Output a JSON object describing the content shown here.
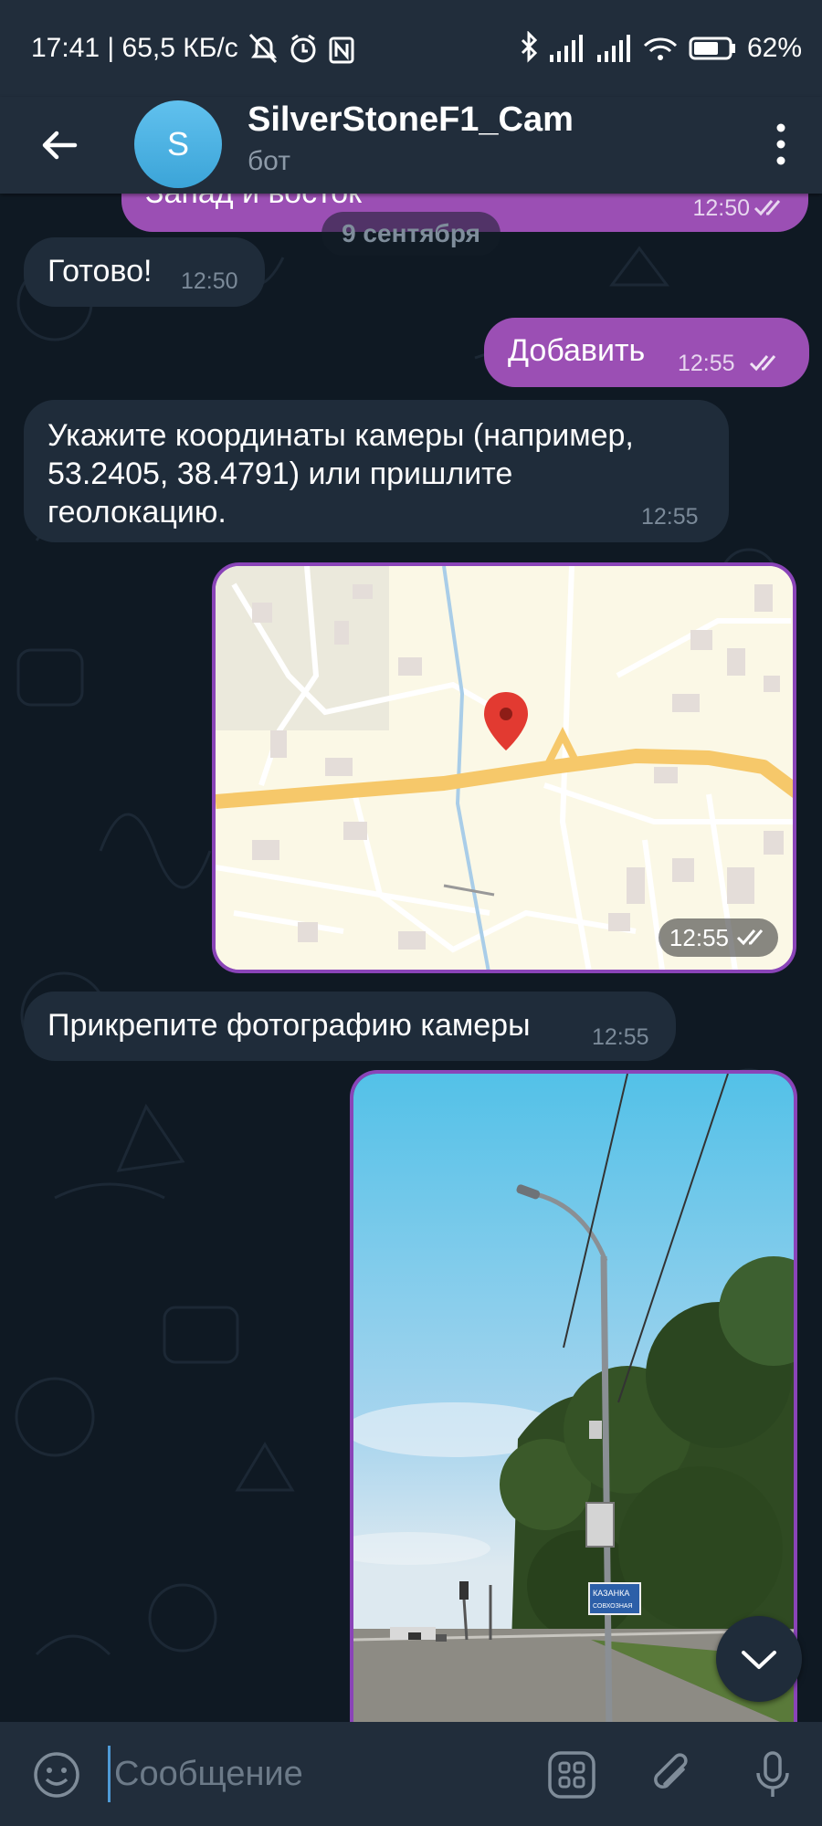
{
  "status_bar": {
    "time_speed": "17:41 | 65,5 КБ/с",
    "battery": "62%"
  },
  "header": {
    "avatar_letter": "S",
    "title": "SilverStoneF1_Cam",
    "subtitle": "бот"
  },
  "chat": {
    "date_separator": "9 сентября",
    "messages": [
      {
        "type": "out",
        "text": "Запад и восток",
        "time": "12:50"
      },
      {
        "type": "in",
        "text": "Готово!",
        "time": "12:50"
      },
      {
        "type": "out",
        "text": "Добавить",
        "time": "12:55"
      },
      {
        "type": "in",
        "lines": [
          "Укажите координаты камеры (например,",
          "53.2405, 38.4791) или пришлите",
          "геолокацию."
        ],
        "time": "12:55"
      },
      {
        "type": "location",
        "time": "12:55"
      },
      {
        "type": "in",
        "text": "Прикрепите фотографию камеры",
        "time": "12:55"
      },
      {
        "type": "photo",
        "sign_text": [
          "КАЗАНКА",
          "СОВХОЗНАЯ"
        ]
      }
    ]
  },
  "composer": {
    "placeholder": "Сообщение"
  },
  "colors": {
    "outgoing_bubble": "#9b4fb4",
    "incoming_bubble": "#1f2c3a",
    "header_bg": "#212d3b",
    "chat_bg": "#0f1923",
    "accent": "#4e9ad6"
  },
  "icons": [
    "back-arrow-icon",
    "more-vertical-icon",
    "emoji-icon",
    "bot-commands-icon",
    "attach-icon",
    "microphone-icon",
    "chevron-down-icon",
    "double-check-icon",
    "map-pin-icon"
  ]
}
